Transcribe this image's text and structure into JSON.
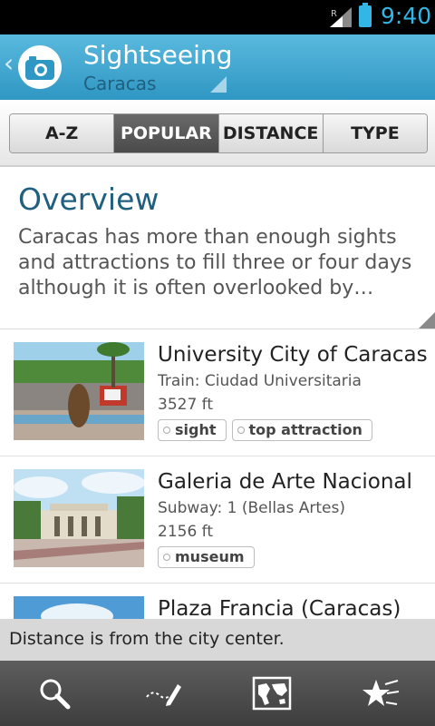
{
  "status_bar": {
    "time": "9:40",
    "signal_label": "R",
    "accent_color": "#33b5e5"
  },
  "header": {
    "title": "Sightseeing",
    "subtitle": "Caracas",
    "icon": "camera-icon",
    "back_icon": "back-chevron-icon"
  },
  "tabs": [
    {
      "label": "A-Z",
      "active": false
    },
    {
      "label": "POPULAR",
      "active": true
    },
    {
      "label": "DISTANCE",
      "active": false
    },
    {
      "label": "TYPE",
      "active": false
    }
  ],
  "overview": {
    "title": "Overview",
    "text": "Caracas has more than enough sights and attractions to fill three or four days although it is often overlooked by…"
  },
  "items": [
    {
      "title": "University City of Caracas",
      "subtitle": "Train: Ciudad Universitaria",
      "distance": "3527 ft",
      "tags": [
        "sight",
        "top attraction"
      ]
    },
    {
      "title": "Galeria de Arte Nacional",
      "subtitle": "Subway: 1 (Bellas Artes)",
      "distance": "2156 ft",
      "tags": [
        "museum"
      ]
    },
    {
      "title": "Plaza Francia (Caracas)",
      "subtitle": "",
      "distance": "",
      "tags": []
    }
  ],
  "toast": {
    "text": "Distance is from the city center."
  },
  "bottom_bar": {
    "buttons": [
      "search-icon",
      "route-pencil-icon",
      "map-icon",
      "favorites-star-icon"
    ]
  },
  "colors": {
    "header": "#3fa6cf",
    "title_text": "#1f5f7f",
    "bottom_bar": "#4a4a4a"
  }
}
